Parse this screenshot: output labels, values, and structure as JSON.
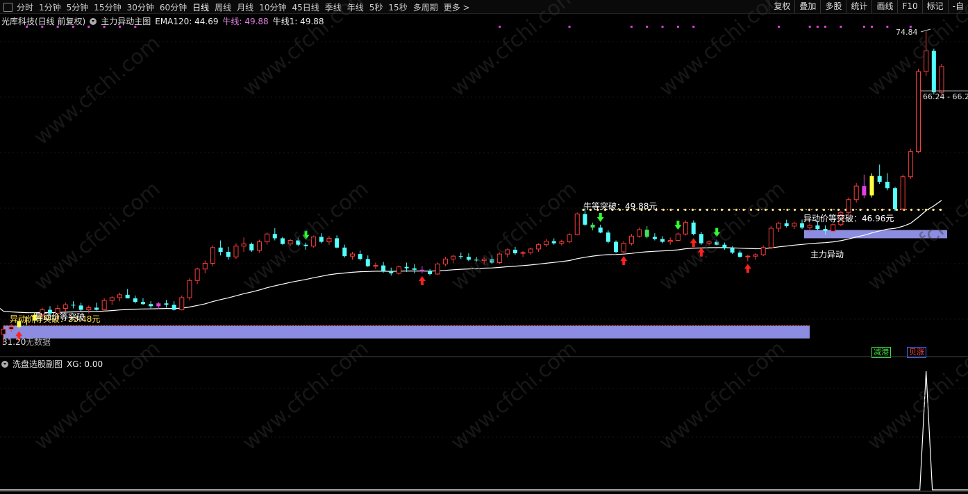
{
  "toolbar": {
    "periods": [
      "分时",
      "1分钟",
      "5分钟",
      "15分钟",
      "30分钟",
      "60分钟",
      "日线",
      "周线",
      "月线",
      "10分钟",
      "45日线",
      "季线",
      "年线",
      "5秒",
      "15秒",
      "多周期",
      "更多 >"
    ],
    "active_period": "日线",
    "tools": [
      "复权",
      "叠加",
      "多股",
      "统计",
      "画线",
      "F10",
      "标记",
      "-自"
    ]
  },
  "main_panel": {
    "stock": "光库科技(日线 前复权)",
    "indicator": "主力异动主图",
    "ema_label": "EMA120: 44.69",
    "bull_label": "牛线: 49.88",
    "bull1_label": "牛线1: 49.88"
  },
  "annotations": {
    "bull_break": "牛等突破：49.88元",
    "abnormal_break": "异动价等突破：46.96元",
    "main_force": "主力异动",
    "old_break": "异动价等突破：33.48元",
    "old_break_overlap": "异动价等突破",
    "no_data": "无数据",
    "low_label": "31.20",
    "high_label": "74.84",
    "range_label": "66.24 - 66.2"
  },
  "sub_panel": {
    "title": "洗盘选股副图",
    "xg_label": "XG: 0.00"
  },
  "badges": {
    "left": "减港",
    "right": "贝涨"
  },
  "colors": {
    "up": "#ff3c3c",
    "down": "#54ffff",
    "purple_zone": "#8c8ce0",
    "white_line": "#ffffff",
    "dotted": "#ffe890",
    "magenta": "#e040e0"
  },
  "chart_data": {
    "type": "candlestick",
    "bull_line": 49.88,
    "abnormal_break": 46.96,
    "old_break": 33.48,
    "ema120_last": 44.69,
    "high": 74.84,
    "low": 31.2,
    "ohlc": [
      [
        32.5,
        33.6,
        31.2,
        33.2
      ],
      [
        33.2,
        33.9,
        32.8,
        33.5
      ],
      [
        33.5,
        34.6,
        33.3,
        34.3
      ],
      [
        34.3,
        35.0,
        33.8,
        34.4
      ],
      [
        34.4,
        35.5,
        34.0,
        35.2
      ],
      [
        35.2,
        36.2,
        34.7,
        35.9
      ],
      [
        35.9,
        36.4,
        35.0,
        35.4
      ],
      [
        35.4,
        36.6,
        35.1,
        36.1
      ],
      [
        36.1,
        36.9,
        35.6,
        36.6
      ],
      [
        36.6,
        37.1,
        36.1,
        36.5
      ],
      [
        36.5,
        36.9,
        35.7,
        35.9
      ],
      [
        35.9,
        36.5,
        35.4,
        36.2
      ],
      [
        36.2,
        36.9,
        35.8,
        35.9
      ],
      [
        35.9,
        37.5,
        35.6,
        37.2
      ],
      [
        37.2,
        37.8,
        36.6,
        37.6
      ],
      [
        37.6,
        38.3,
        37.1,
        38.0
      ],
      [
        38.0,
        38.8,
        37.5,
        37.5
      ],
      [
        37.5,
        37.9,
        36.8,
        37.0
      ],
      [
        37.0,
        37.5,
        36.6,
        36.7
      ],
      [
        36.7,
        37.1,
        36.1,
        36.4
      ],
      [
        36.4,
        37.0,
        36.0,
        36.8
      ],
      [
        36.8,
        37.3,
        36.2,
        36.6
      ],
      [
        36.6,
        37.1,
        35.8,
        35.9
      ],
      [
        35.9,
        37.9,
        35.8,
        37.6
      ],
      [
        37.6,
        40.3,
        37.2,
        40.0
      ],
      [
        40.0,
        41.8,
        39.5,
        41.6
      ],
      [
        41.6,
        42.8,
        41.0,
        42.4
      ],
      [
        42.4,
        44.9,
        42.0,
        44.6
      ],
      [
        44.6,
        45.6,
        43.5,
        44.0
      ],
      [
        44.0,
        44.7,
        42.9,
        43.3
      ],
      [
        43.3,
        45.2,
        43.0,
        44.8
      ],
      [
        44.8,
        46.0,
        44.0,
        45.1
      ],
      [
        45.1,
        45.3,
        44.0,
        44.2
      ],
      [
        44.2,
        45.7,
        43.9,
        45.4
      ],
      [
        45.4,
        46.7,
        45.0,
        46.5
      ],
      [
        46.5,
        47.3,
        45.6,
        45.9
      ],
      [
        45.9,
        46.1,
        45.0,
        45.1
      ],
      [
        45.1,
        45.8,
        44.8,
        45.6
      ],
      [
        45.6,
        46.0,
        44.8,
        45.0
      ],
      [
        45.0,
        45.3,
        44.3,
        44.8
      ],
      [
        44.8,
        46.3,
        44.6,
        46.1
      ],
      [
        46.1,
        46.6,
        45.2,
        45.4
      ],
      [
        45.4,
        46.2,
        45.0,
        45.9
      ],
      [
        45.9,
        46.3,
        44.5,
        44.6
      ],
      [
        44.6,
        45.0,
        43.2,
        43.4
      ],
      [
        43.4,
        44.0,
        42.9,
        43.7
      ],
      [
        43.7,
        44.2,
        42.8,
        43.0
      ],
      [
        43.0,
        43.5,
        41.9,
        42.0
      ],
      [
        42.0,
        42.5,
        41.6,
        42.1
      ],
      [
        42.1,
        42.6,
        41.1,
        41.3
      ],
      [
        41.3,
        41.8,
        40.7,
        41.0
      ],
      [
        41.0,
        42.1,
        40.8,
        41.9
      ],
      [
        41.9,
        42.5,
        41.2,
        41.7
      ],
      [
        41.7,
        42.3,
        41.0,
        41.5
      ],
      [
        41.5,
        42.0,
        41.0,
        41.3
      ],
      [
        41.3,
        41.6,
        40.7,
        40.9
      ],
      [
        40.9,
        42.5,
        40.8,
        42.3
      ],
      [
        42.3,
        43.3,
        42.0,
        43.0
      ],
      [
        43.0,
        43.6,
        42.4,
        43.4
      ],
      [
        43.4,
        43.9,
        43.0,
        43.3
      ],
      [
        43.3,
        43.8,
        42.7,
        42.9
      ],
      [
        42.9,
        43.3,
        42.6,
        42.8
      ],
      [
        42.8,
        43.3,
        42.2,
        43.0
      ],
      [
        43.0,
        43.5,
        42.3,
        42.5
      ],
      [
        42.5,
        43.9,
        42.3,
        43.7
      ],
      [
        43.7,
        44.5,
        43.2,
        44.3
      ],
      [
        44.3,
        44.7,
        43.6,
        43.8
      ],
      [
        43.8,
        44.1,
        43.3,
        43.9
      ],
      [
        43.9,
        44.6,
        43.6,
        44.4
      ],
      [
        44.4,
        45.2,
        44.0,
        45.0
      ],
      [
        45.0,
        45.8,
        44.7,
        45.5
      ],
      [
        45.5,
        45.9,
        45.0,
        45.2
      ],
      [
        45.2,
        45.7,
        44.9,
        45.4
      ],
      [
        45.4,
        46.6,
        45.2,
        46.4
      ],
      [
        46.4,
        49.5,
        46.3,
        49.3
      ],
      [
        49.3,
        50.1,
        47.6,
        47.8
      ],
      [
        47.8,
        48.1,
        47.0,
        47.4
      ],
      [
        47.4,
        47.8,
        46.6,
        46.7
      ],
      [
        46.7,
        47.0,
        45.2,
        45.4
      ],
      [
        45.4,
        45.6,
        43.8,
        44.0
      ],
      [
        44.0,
        45.5,
        43.8,
        45.2
      ],
      [
        45.2,
        46.5,
        44.9,
        46.2
      ],
      [
        46.2,
        47.4,
        46.0,
        47.1
      ],
      [
        47.1,
        47.6,
        45.9,
        46.1
      ],
      [
        46.1,
        46.6,
        45.6,
        45.8
      ],
      [
        45.8,
        46.2,
        45.2,
        45.4
      ],
      [
        45.4,
        46.0,
        45.0,
        45.6
      ],
      [
        45.6,
        46.7,
        45.5,
        46.5
      ],
      [
        46.5,
        48.4,
        46.3,
        48.1
      ],
      [
        48.1,
        48.4,
        46.3,
        46.5
      ],
      [
        46.5,
        46.8,
        45.0,
        45.2
      ],
      [
        45.2,
        45.6,
        44.9,
        45.4
      ],
      [
        45.4,
        45.7,
        44.9,
        45.0
      ],
      [
        45.0,
        45.3,
        44.3,
        44.5
      ],
      [
        44.5,
        44.8,
        43.7,
        43.9
      ],
      [
        43.9,
        44.2,
        43.2,
        43.3
      ],
      [
        43.3,
        43.6,
        42.7,
        43.4
      ],
      [
        43.4,
        43.8,
        42.9,
        43.6
      ],
      [
        43.6,
        44.9,
        43.4,
        44.6
      ],
      [
        44.6,
        47.6,
        44.4,
        47.3
      ],
      [
        47.3,
        48.2,
        46.8,
        48.0
      ],
      [
        48.0,
        48.5,
        47.4,
        47.6
      ],
      [
        47.6,
        48.2,
        47.2,
        48.0
      ],
      [
        48.0,
        48.5,
        47.2,
        47.4
      ],
      [
        47.4,
        48.0,
        46.8,
        47.7
      ],
      [
        47.7,
        48.3,
        47.0,
        47.2
      ],
      [
        47.2,
        47.7,
        46.4,
        46.9
      ],
      [
        46.9,
        48.0,
        46.7,
        47.8
      ],
      [
        47.8,
        49.7,
        47.6,
        49.5
      ],
      [
        49.5,
        51.6,
        49.2,
        51.3
      ],
      [
        51.3,
        53.6,
        50.9,
        53.2
      ],
      [
        53.2,
        54.8,
        51.5,
        51.9
      ],
      [
        51.9,
        55.0,
        51.6,
        54.6
      ],
      [
        54.6,
        56.2,
        53.5,
        53.8
      ],
      [
        53.8,
        55.0,
        52.6,
        52.9
      ],
      [
        52.9,
        53.1,
        49.7,
        50.0
      ],
      [
        50.0,
        54.8,
        49.8,
        54.5
      ],
      [
        54.5,
        58.4,
        54.2,
        58.0
      ],
      [
        58.0,
        69.6,
        57.8,
        69.2
      ],
      [
        69.2,
        74.8,
        68.6,
        72.1
      ],
      [
        72.1,
        72.4,
        66.0,
        66.3
      ],
      [
        66.3,
        70.3,
        66.0,
        69.9
      ]
    ],
    "markers": {
      "magenta": [
        20,
        54,
        111
      ],
      "yellow": [
        2,
        3,
        4,
        112
      ],
      "up_arrow": [
        2,
        54,
        80,
        89,
        90,
        96
      ],
      "down_arrow": [
        39,
        77,
        87,
        92
      ],
      "green_candle": [
        76,
        83
      ]
    },
    "xg_spike_index": 119
  }
}
